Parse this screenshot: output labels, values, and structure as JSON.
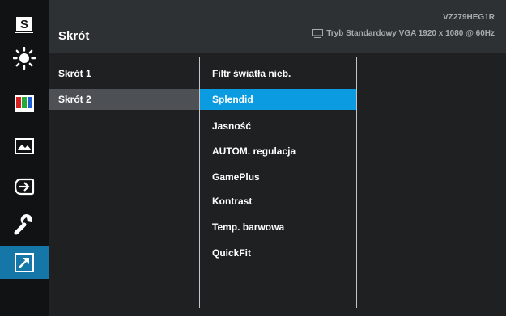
{
  "header": {
    "title": "Skrót",
    "model": "VZ279HEG1R",
    "status": "Tryb Standardowy VGA  1920 x 1080 @ 60Hz"
  },
  "sidebar": {
    "items": [
      {
        "icon": "splendid-s-icon",
        "label": "S"
      },
      {
        "icon": "brightness-sun-icon"
      },
      {
        "icon": "color-bars-icon"
      },
      {
        "icon": "image-landscape-icon"
      },
      {
        "icon": "input-select-icon"
      },
      {
        "icon": "system-wrench-icon"
      },
      {
        "icon": "shortcut-arrow-icon",
        "active": true
      }
    ]
  },
  "shortcut_list": [
    {
      "label": "Skrót 1"
    },
    {
      "label": "Skrót 2",
      "selected": true
    }
  ],
  "function_list": [
    {
      "label": "Filtr światła nieb."
    },
    {
      "label": "Splendid",
      "highlighted": true
    },
    {
      "label": "Jasność"
    },
    {
      "label": "AUTOM. regulacja"
    },
    {
      "label": "GamePlus"
    },
    {
      "label": "Kontrast"
    },
    {
      "label": "Temp. barwowa"
    },
    {
      "label": "QuickFit"
    }
  ],
  "colors": {
    "active_sidebar": "#1577a8",
    "highlight": "#0b9be0",
    "selected": "#4d5156"
  }
}
